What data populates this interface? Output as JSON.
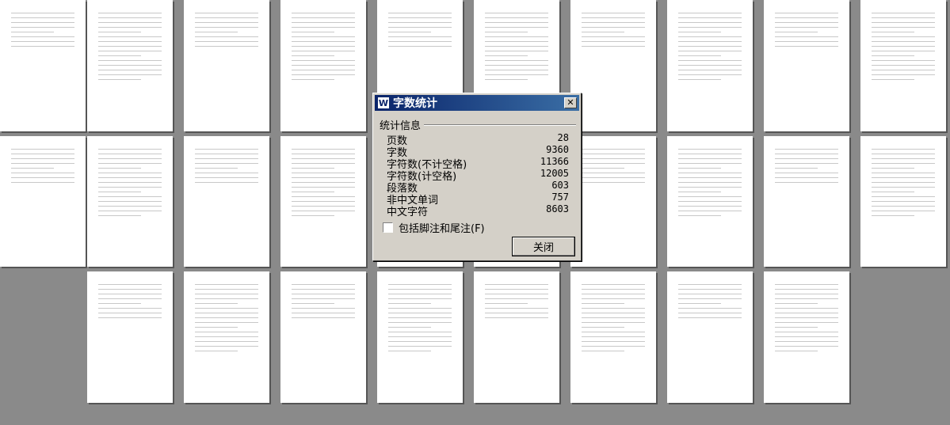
{
  "dialog": {
    "title": "字数统计",
    "group_label": "统计信息",
    "stats": [
      {
        "label": "页数",
        "value": "28"
      },
      {
        "label": "字数",
        "value": "9360"
      },
      {
        "label": "字符数(不计空格)",
        "value": "11366"
      },
      {
        "label": "字符数(计空格)",
        "value": "12005"
      },
      {
        "label": "段落数",
        "value": "603"
      },
      {
        "label": "非中文单词",
        "value": "757"
      },
      {
        "label": "中文字符",
        "value": "8603"
      }
    ],
    "checkbox_label": "包括脚注和尾注(F)",
    "checkbox_checked": false,
    "close_label": "关闭",
    "close_x": "✕"
  },
  "document": {
    "page_count": 28
  }
}
